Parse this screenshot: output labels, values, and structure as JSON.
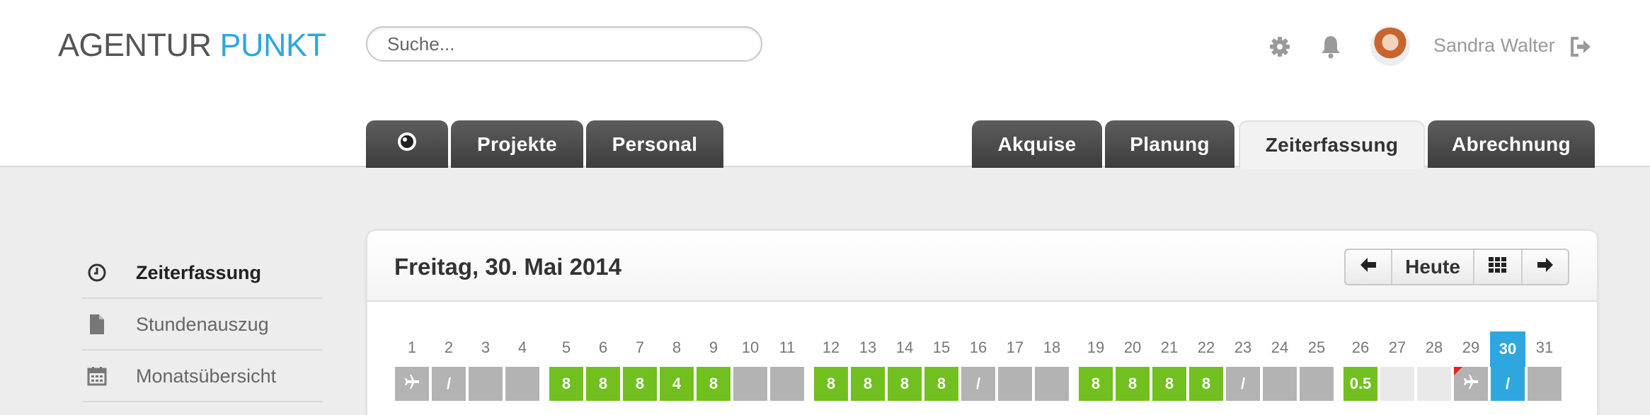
{
  "header": {
    "logo_part1": "AGENTUR",
    "logo_part2": "PUNKT",
    "search_placeholder": "Suche...",
    "user_name": "Sandra Walter",
    "icons": [
      "gear-icon",
      "bell-icon",
      "avatar",
      "logout-icon"
    ],
    "accent_color": "#2ea7e0"
  },
  "tabs": [
    {
      "label": "",
      "icon": "eye-icon"
    },
    {
      "label": "Projekte"
    },
    {
      "label": "Personal"
    },
    {
      "label": "Akquise"
    },
    {
      "label": "Planung"
    },
    {
      "label": "Zeiterfassung",
      "active": true
    },
    {
      "label": "Abrechnung"
    }
  ],
  "sidebar": {
    "items": [
      {
        "label": "Zeiterfassung",
        "icon": "clock-icon",
        "active": true
      },
      {
        "label": "Stundenauszug",
        "icon": "document-icon"
      },
      {
        "label": "Monatsübersicht",
        "icon": "calendar-icon"
      }
    ]
  },
  "panel": {
    "title": "Freitag, 30. Mai 2014",
    "today_label": "Heute",
    "nav_icons": [
      "arrow-left-icon",
      "grid-icon",
      "arrow-right-icon"
    ]
  },
  "calendar": {
    "days": [
      {
        "day": "1",
        "value": "",
        "type": "gray",
        "icon": "plane"
      },
      {
        "day": "2",
        "value": "/",
        "type": "gray"
      },
      {
        "day": "3",
        "value": "",
        "type": "gray"
      },
      {
        "day": "4",
        "value": "",
        "type": "gray"
      },
      {
        "day": "5",
        "value": "8",
        "type": "green"
      },
      {
        "day": "6",
        "value": "8",
        "type": "green"
      },
      {
        "day": "7",
        "value": "8",
        "type": "green"
      },
      {
        "day": "8",
        "value": "4",
        "type": "green"
      },
      {
        "day": "9",
        "value": "8",
        "type": "green"
      },
      {
        "day": "10",
        "value": "",
        "type": "gray"
      },
      {
        "day": "11",
        "value": "",
        "type": "gray"
      },
      {
        "day": "12",
        "value": "8",
        "type": "green"
      },
      {
        "day": "13",
        "value": "8",
        "type": "green"
      },
      {
        "day": "14",
        "value": "8",
        "type": "green"
      },
      {
        "day": "15",
        "value": "8",
        "type": "green"
      },
      {
        "day": "16",
        "value": "/",
        "type": "gray"
      },
      {
        "day": "17",
        "value": "",
        "type": "gray"
      },
      {
        "day": "18",
        "value": "",
        "type": "gray"
      },
      {
        "day": "19",
        "value": "8",
        "type": "green"
      },
      {
        "day": "20",
        "value": "8",
        "type": "green"
      },
      {
        "day": "21",
        "value": "8",
        "type": "green"
      },
      {
        "day": "22",
        "value": "8",
        "type": "green"
      },
      {
        "day": "23",
        "value": "/",
        "type": "gray"
      },
      {
        "day": "24",
        "value": "",
        "type": "gray"
      },
      {
        "day": "25",
        "value": "",
        "type": "gray"
      },
      {
        "day": "26",
        "value": "0.5",
        "type": "green"
      },
      {
        "day": "27",
        "value": "",
        "type": "light"
      },
      {
        "day": "28",
        "value": "",
        "type": "light"
      },
      {
        "day": "29",
        "value": "",
        "type": "gray",
        "icon": "plane",
        "flag": true
      },
      {
        "day": "30",
        "value": "/",
        "type": "blue",
        "today": true
      },
      {
        "day": "31",
        "value": "",
        "type": "gray"
      }
    ]
  }
}
